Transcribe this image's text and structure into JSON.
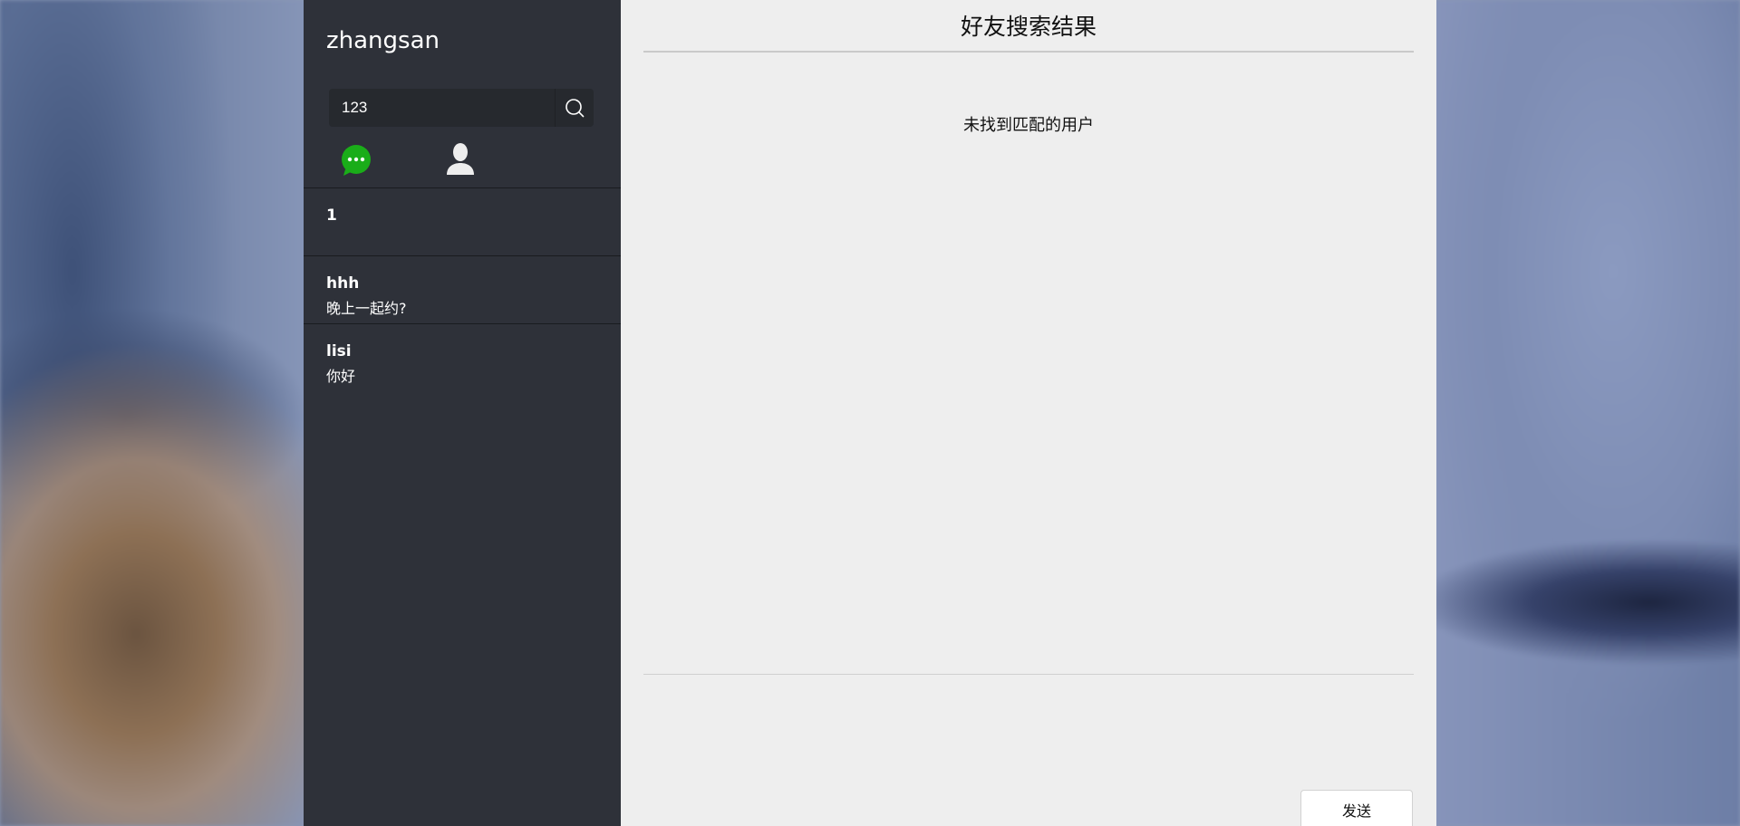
{
  "sidebar": {
    "username": "zhangsan",
    "search": {
      "value": "123",
      "icon": "search-icon"
    },
    "tabs": [
      {
        "icon": "chat-bubble-icon",
        "color": "#1aad19"
      },
      {
        "icon": "user-icon",
        "color": "#eeeeee"
      }
    ],
    "conversations": [
      {
        "name": "1",
        "last_message": ""
      },
      {
        "name": "hhh",
        "last_message": "晚上一起约?"
      },
      {
        "name": "lisi",
        "last_message": "你好"
      }
    ]
  },
  "main": {
    "title": "好友搜索结果",
    "empty_message": "未找到匹配的用户",
    "send_label": "发送"
  },
  "colors": {
    "sidebar_bg": "#2e3139",
    "main_bg": "#eeeeee",
    "accent_green": "#1aad19"
  }
}
